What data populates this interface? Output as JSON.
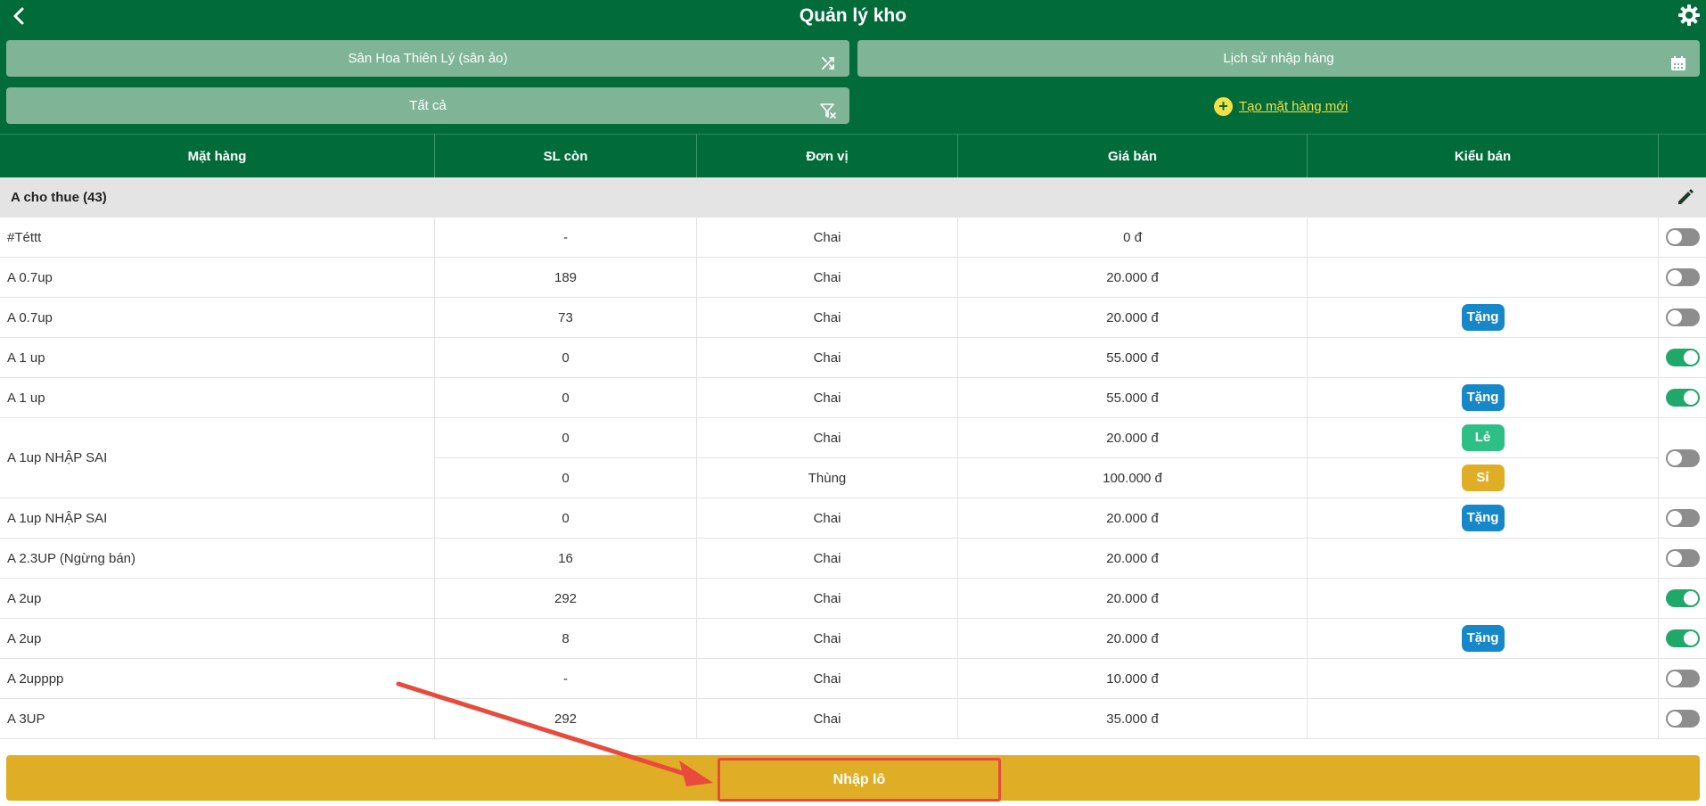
{
  "header": {
    "title": "Quản lý kho",
    "store_label": "Sân Hoa Thiên Lý (sân ảo)",
    "history_label": "Lịch sử nhập hàng",
    "filter_label": "Tất cả",
    "create_label": "Tạo mặt hàng mới",
    "create_icon": "plus-circle-icon"
  },
  "table": {
    "columns": [
      "Mặt hàng",
      "SL còn",
      "Đơn vị",
      "Giá bán",
      "Kiểu bán"
    ],
    "group": {
      "title": "A cho thue (43)"
    },
    "rows": [
      {
        "name": "#Téttt",
        "qty": "-",
        "unit": "Chai",
        "price": "0 đ",
        "type": "",
        "enabled": false
      },
      {
        "name": "A 0.7up",
        "qty": "189",
        "unit": "Chai",
        "price": "20.000 đ",
        "type": "",
        "enabled": false
      },
      {
        "name": "A 0.7up",
        "qty": "73",
        "unit": "Chai",
        "price": "20.000 đ",
        "type": "Tặng",
        "enabled": false
      },
      {
        "name": "A 1 up",
        "qty": "0",
        "unit": "Chai",
        "price": "55.000 đ",
        "type": "",
        "enabled": true
      },
      {
        "name": "A 1 up",
        "qty": "0",
        "unit": "Chai",
        "price": "55.000 đ",
        "type": "Tặng",
        "enabled": true
      },
      {
        "name": "A 1up NHẬP SAI",
        "enabled": false,
        "variants": [
          {
            "qty": "0",
            "unit": "Chai",
            "price": "20.000 đ",
            "type": "Lẻ"
          },
          {
            "qty": "0",
            "unit": "Thùng",
            "price": "100.000 đ",
            "type": "Sỉ"
          }
        ]
      },
      {
        "name": "A 1up NHẬP SAI",
        "qty": "0",
        "unit": "Chai",
        "price": "20.000 đ",
        "type": "Tặng",
        "enabled": false
      },
      {
        "name": "A 2.3UP (Ngừng bán)",
        "qty": "16",
        "unit": "Chai",
        "price": "20.000 đ",
        "type": "",
        "enabled": false
      },
      {
        "name": "A 2up",
        "qty": "292",
        "unit": "Chai",
        "price": "20.000 đ",
        "type": "",
        "enabled": true
      },
      {
        "name": "A 2up",
        "qty": "8",
        "unit": "Chai",
        "price": "20.000 đ",
        "type": "Tặng",
        "enabled": true
      },
      {
        "name": "A 2upppp",
        "qty": "-",
        "unit": "Chai",
        "price": "10.000 đ",
        "type": "",
        "enabled": false
      },
      {
        "name": "A 3UP",
        "qty": "292",
        "unit": "Chai",
        "price": "35.000 đ",
        "type": "",
        "enabled": false
      }
    ]
  },
  "footer": {
    "import_label": "Nhập lô"
  },
  "colors": {
    "brand_green": "#016B39",
    "header_button": "#7FB596",
    "accent_yellow": "#E0AE26",
    "tag_gift": "#1688C9",
    "tag_retail": "#2DBF84",
    "tag_wholesale": "#E0AE26",
    "toggle_on": "#20A86B",
    "highlight_red": "#E84A3C"
  }
}
